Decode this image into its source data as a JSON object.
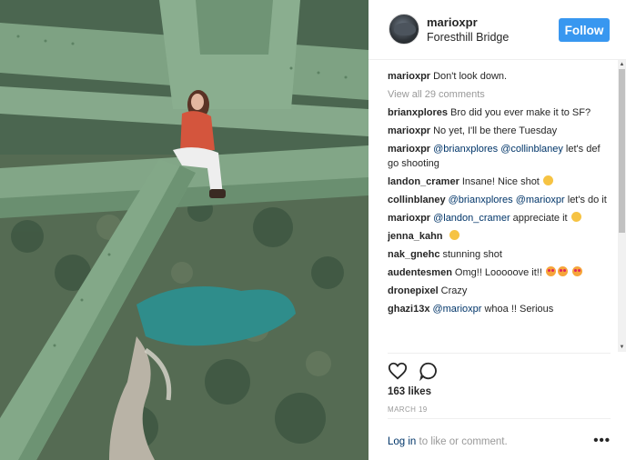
{
  "post": {
    "username": "marioxpr",
    "location": "Foresthill Bridge",
    "follow_label": "Follow"
  },
  "caption": {
    "username": "marioxpr",
    "text": "Don't look down."
  },
  "view_all_label": "View all 29 comments",
  "comments": [
    {
      "user": "brianxplores",
      "mention": "",
      "text": "Bro did you ever make it to SF?"
    },
    {
      "user": "marioxpr",
      "mention": "",
      "text": "No yet, I'll be there Tuesday"
    },
    {
      "user": "marioxpr",
      "mention": "@brianxplores @collinblaney",
      "text": " let's def go shooting"
    },
    {
      "user": "landon_cramer",
      "mention": "",
      "text": "Insane! Nice shot",
      "emoji": "clap-emoji"
    },
    {
      "user": "collinblaney",
      "mention": "@brianxplores @marioxpr",
      "text": " let's do it"
    },
    {
      "user": "marioxpr",
      "mention": "@landon_cramer",
      "text": " appreciate it",
      "emoji": "bow-emoji"
    },
    {
      "user": "jenna_kahn",
      "mention": "",
      "text": "",
      "emoji": "hand-emoji"
    },
    {
      "user": "nak_gnehc",
      "mention": "",
      "text": "stunning shot"
    },
    {
      "user": "audentesmen",
      "mention": "",
      "text": "Omg!! Looooove it!!",
      "emoji": "heart-eyes-emoji"
    },
    {
      "user": "dronepixel",
      "mention": "",
      "text": "Crazy"
    },
    {
      "user": "ghazi13x",
      "mention": "@marioxpr",
      "text": " whoa !! Serious"
    }
  ],
  "actions": {
    "likes": "163 likes",
    "date": "MARCH 19"
  },
  "footer": {
    "login_link": "Log in",
    "login_rest": " to like or comment.",
    "more_label": "•••"
  },
  "colors": {
    "accent": "#3897f0",
    "link": "#003569",
    "muted": "#999999",
    "bridge_green": "#7fa382"
  }
}
